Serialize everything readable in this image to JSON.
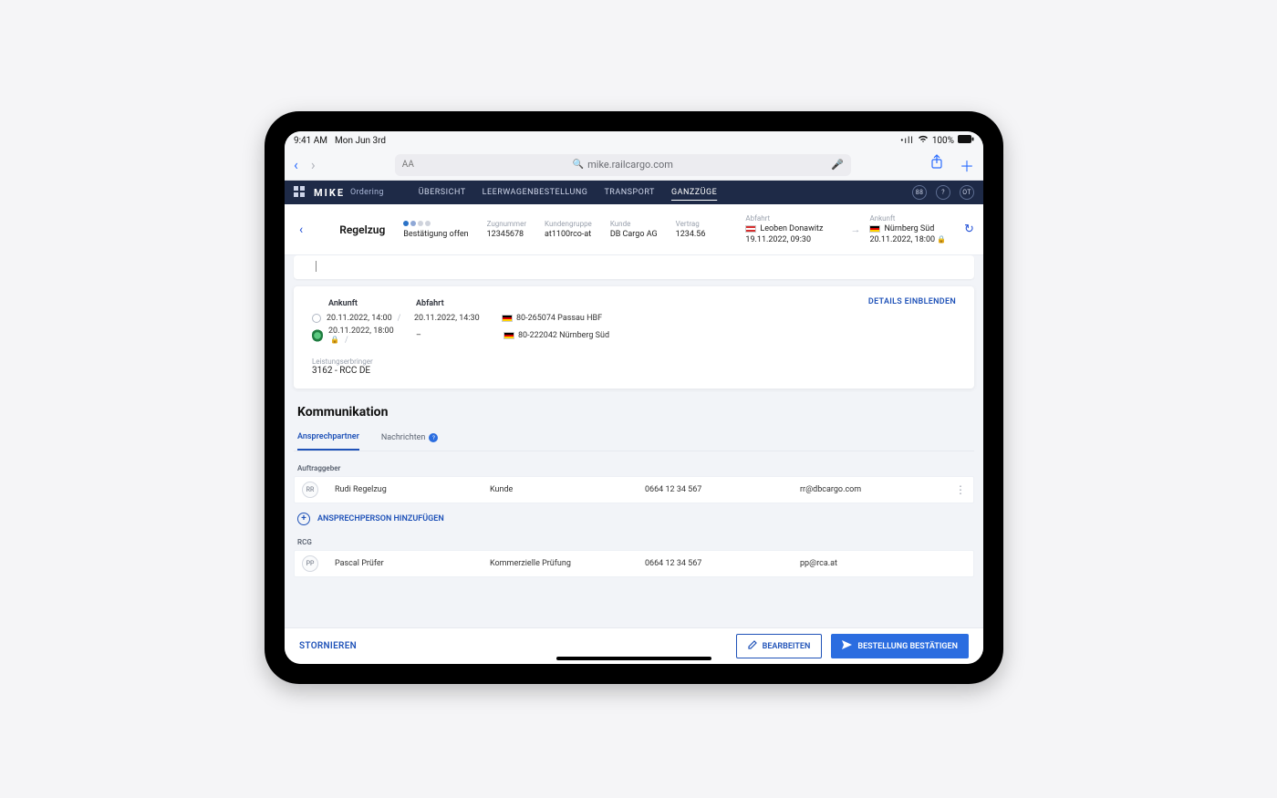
{
  "statusbar": {
    "time": "9:41 AM",
    "date": "Mon Jun 3rd",
    "signal": "•ıll",
    "wifi": "⌃",
    "battery_pct": "100%"
  },
  "browser": {
    "url": "mike.railcargo.com",
    "aA": "AA"
  },
  "app": {
    "brand": "MIKE",
    "section": "Ordering",
    "tabs": {
      "overview": "ÜBERSICHT",
      "empty": "LEERWAGENBESTELLUNG",
      "transport": "TRANSPORT",
      "trains": "GANZZÜGE"
    },
    "hdr_badges": {
      "b1": "88",
      "b2": "?",
      "b3": "OT"
    }
  },
  "summary": {
    "title": "Regelzug",
    "status_label": "Bestätigung offen",
    "cols": {
      "zugnummer": {
        "lbl": "Zugnummer",
        "val": "12345678"
      },
      "kundengruppe": {
        "lbl": "Kundengruppe",
        "val": "at1100rco-at"
      },
      "kunde": {
        "lbl": "Kunde",
        "val": "DB Cargo AG"
      },
      "vertrag": {
        "lbl": "Vertrag",
        "val": "1234.56"
      }
    },
    "abfahrt": {
      "lbl": "Abfahrt",
      "place": "Leoben Donawitz",
      "ts": "19.11.2022, 09:30"
    },
    "ankunft": {
      "lbl": "Ankunft",
      "place": "Nürnberg Süd",
      "ts": "20.11.2022, 18:00"
    }
  },
  "routecard": {
    "details_link": "DETAILS EINBLENDEN",
    "hdr_ank": "Ankunft",
    "hdr_abf": "Abfahrt",
    "rows": [
      {
        "ank": "20.11.2022, 14:00",
        "abf": "20.11.2022, 14:30",
        "loc": "80-265074 Passau HBF",
        "flag": "de",
        "pin": false
      },
      {
        "ank": "20.11.2022, 18:00",
        "abf": "–",
        "loc": "80-222042 Nürnberg Süd",
        "flag": "de",
        "pin": true
      }
    ],
    "provider": {
      "lbl": "Leistungserbringer",
      "val": "3162 - RCC DE"
    }
  },
  "comm": {
    "title": "Kommunikation",
    "tabs": {
      "contacts": "Ansprechpartner",
      "messages": "Nachrichten"
    },
    "group_client": "Auftraggeber",
    "group_rcg": "RCG",
    "contacts": {
      "client": {
        "initials": "RR",
        "name": "Rudi Regelzug",
        "role": "Kunde",
        "phone": "0664 12 34 567",
        "email": "rr@dbcargo.com"
      },
      "rcg": {
        "initials": "PP",
        "name": "Pascal Prüfer",
        "role": "Kommerzielle Prüfung",
        "phone": "0664 12 34 567",
        "email": "pp@rca.at"
      }
    },
    "add_label": "ANSPRECHPERSON HINZUFÜGEN"
  },
  "actions": {
    "cancel": "STORNIEREN",
    "edit": "BEARBEITEN",
    "confirm": "BESTELLUNG BESTÄTIGEN"
  }
}
